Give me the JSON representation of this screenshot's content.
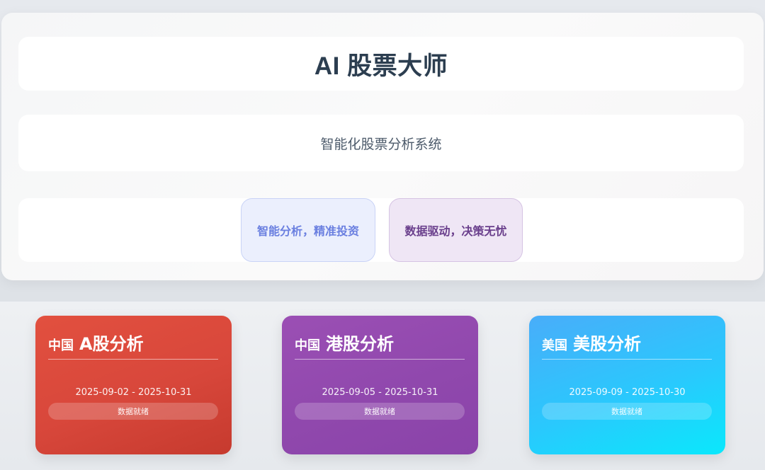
{
  "header": {
    "title": "AI 股票大师",
    "subtitle": "智能化股票分析系统",
    "tags": [
      "智能分析，精准投资",
      "数据驱动，决策无忧"
    ]
  },
  "markets": [
    {
      "flag_text": "中国",
      "title": "A股分析",
      "date_range": "2025-09-02 - 2025-10-31",
      "status": "数据就绪"
    },
    {
      "flag_text": "中国",
      "title": "港股分析",
      "date_range": "2025-09-05 - 2025-10-31",
      "status": "数据就绪"
    },
    {
      "flag_text": "美国",
      "title": "美股分析",
      "date_range": "2025-09-09 - 2025-10-30",
      "status": "数据就绪"
    }
  ],
  "colors": {
    "title": "#2c3e50",
    "a_share": "#d8473b",
    "hk_share": "#9048ad",
    "us_share": "#2ac8fd"
  }
}
